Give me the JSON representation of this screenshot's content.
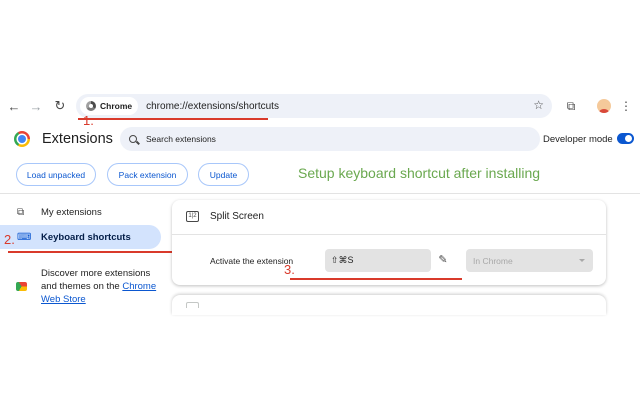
{
  "browser": {
    "chip_label": "Chrome",
    "url": "chrome://extensions/shortcuts"
  },
  "header": {
    "title": "Extensions",
    "search_placeholder": "Search extensions",
    "developer_mode_label": "Developer mode",
    "developer_mode_on": true
  },
  "actions": {
    "load_unpacked": "Load unpacked",
    "pack_extension": "Pack extension",
    "update": "Update"
  },
  "caption": "Setup keyboard shortcut after installing",
  "sidebar": {
    "items": [
      {
        "label": "My extensions",
        "icon": "puzzle-icon",
        "active": false
      },
      {
        "label": "Keyboard shortcuts",
        "icon": "keyboard-icon",
        "active": true
      }
    ],
    "discover_text": "Discover more extensions and themes on the ",
    "discover_link": "Chrome Web Store"
  },
  "card": {
    "extension_name": "Split Screen",
    "action_label": "Activate the extension",
    "shortcut": "⇧⌘S",
    "scope": "In Chrome"
  },
  "annotations": {
    "one": "1.",
    "two": "2.",
    "three": "3."
  },
  "colors": {
    "accent": "#0b57d0",
    "annotation_red": "#d93a2b",
    "caption_green": "#6aa84f",
    "active_nav_bg": "#d3e3fd"
  }
}
